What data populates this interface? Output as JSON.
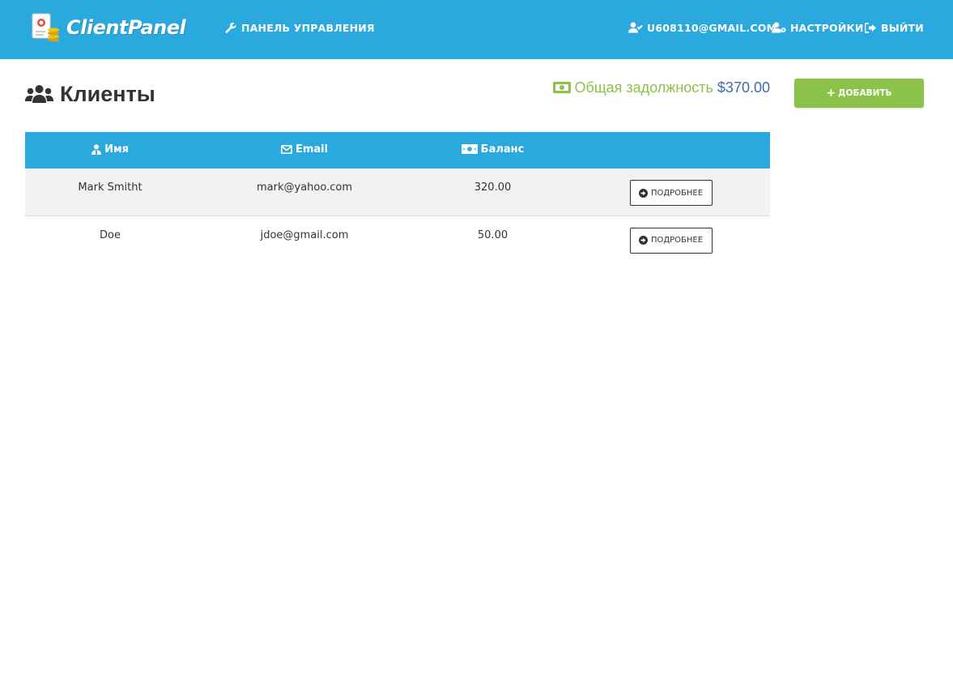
{
  "navbar": {
    "brand": "ClientPanel",
    "dashboard": "ПАНЕЛЬ УПРАВЛЕНИЯ",
    "user_email": "U608110@GMAIL.COM",
    "settings": "НАСТРОЙКИ",
    "logout": "ВЫЙТИ"
  },
  "page": {
    "title": "Клиенты",
    "total_label": "Общая задолжность",
    "total_value": "$370.00",
    "add_label": "ДОБАВИТЬ"
  },
  "table": {
    "headers": {
      "name": "Имя",
      "email": "Email",
      "balance": "Баланс"
    },
    "rows": [
      {
        "name": "Mark Smitht",
        "email": "mark@yahoo.com",
        "balance": "320.00",
        "action": "ПОДРОБНЕЕ"
      },
      {
        "name": "Doe",
        "email": "jdoe@gmail.com",
        "balance": "50.00",
        "action": "ПОДРОБНЕЕ"
      }
    ]
  },
  "colors": {
    "primary": "#2aa9df",
    "success": "#8bc34a",
    "value_blue": "#3a6ea5"
  },
  "icons": {
    "brand": "certificate-coins-icon",
    "dashboard": "wrench-icon",
    "user": "user-check-icon",
    "settings": "user-cog-icon",
    "logout": "sign-out-icon",
    "page_title": "users-icon",
    "total": "money-bill-icon",
    "add": "plus-icon",
    "name_header": "user-tie-icon",
    "email_header": "envelope-icon",
    "balance_header": "money-bill-icon",
    "details": "arrow-circle-right-icon"
  }
}
